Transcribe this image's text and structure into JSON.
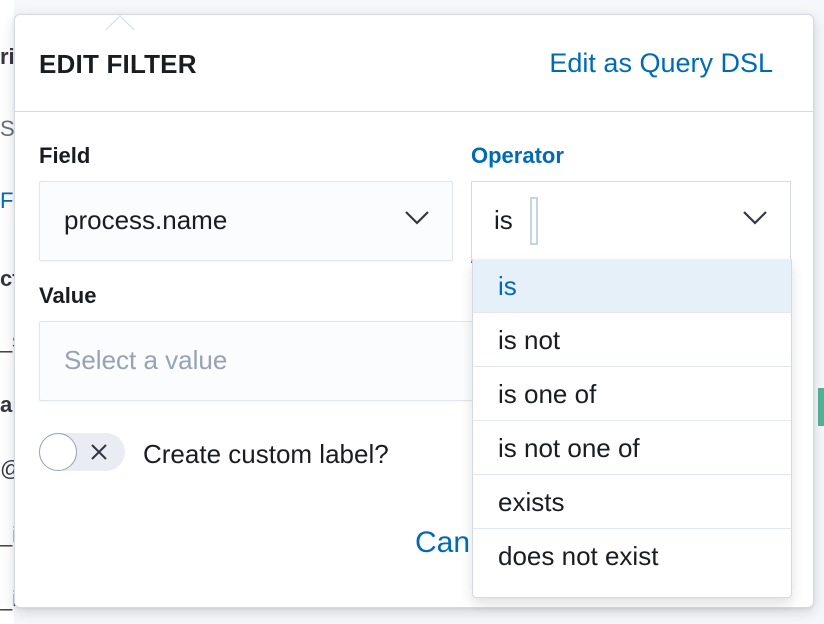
{
  "background": {
    "fragments": [
      "ri",
      "S",
      "F",
      "ct",
      "_s",
      "a",
      "@",
      "_i",
      "_i"
    ]
  },
  "popover": {
    "title": "EDIT FILTER",
    "dsl_link": "Edit as Query DSL",
    "field": {
      "label": "Field",
      "value": "process.name"
    },
    "operator": {
      "label": "Operator",
      "value": "is",
      "options": [
        "is",
        "is not",
        "is one of",
        "is not one of",
        "exists",
        "does not exist"
      ],
      "selected_index": 0
    },
    "value_field": {
      "label": "Value",
      "placeholder": "Select a value"
    },
    "custom_label_toggle": {
      "label": "Create custom label?",
      "checked": false
    },
    "cancel_label": "Can"
  },
  "colors": {
    "accent": "#006bb4",
    "selected_bg": "#e6f0f8",
    "placeholder": "#98a2b3"
  }
}
